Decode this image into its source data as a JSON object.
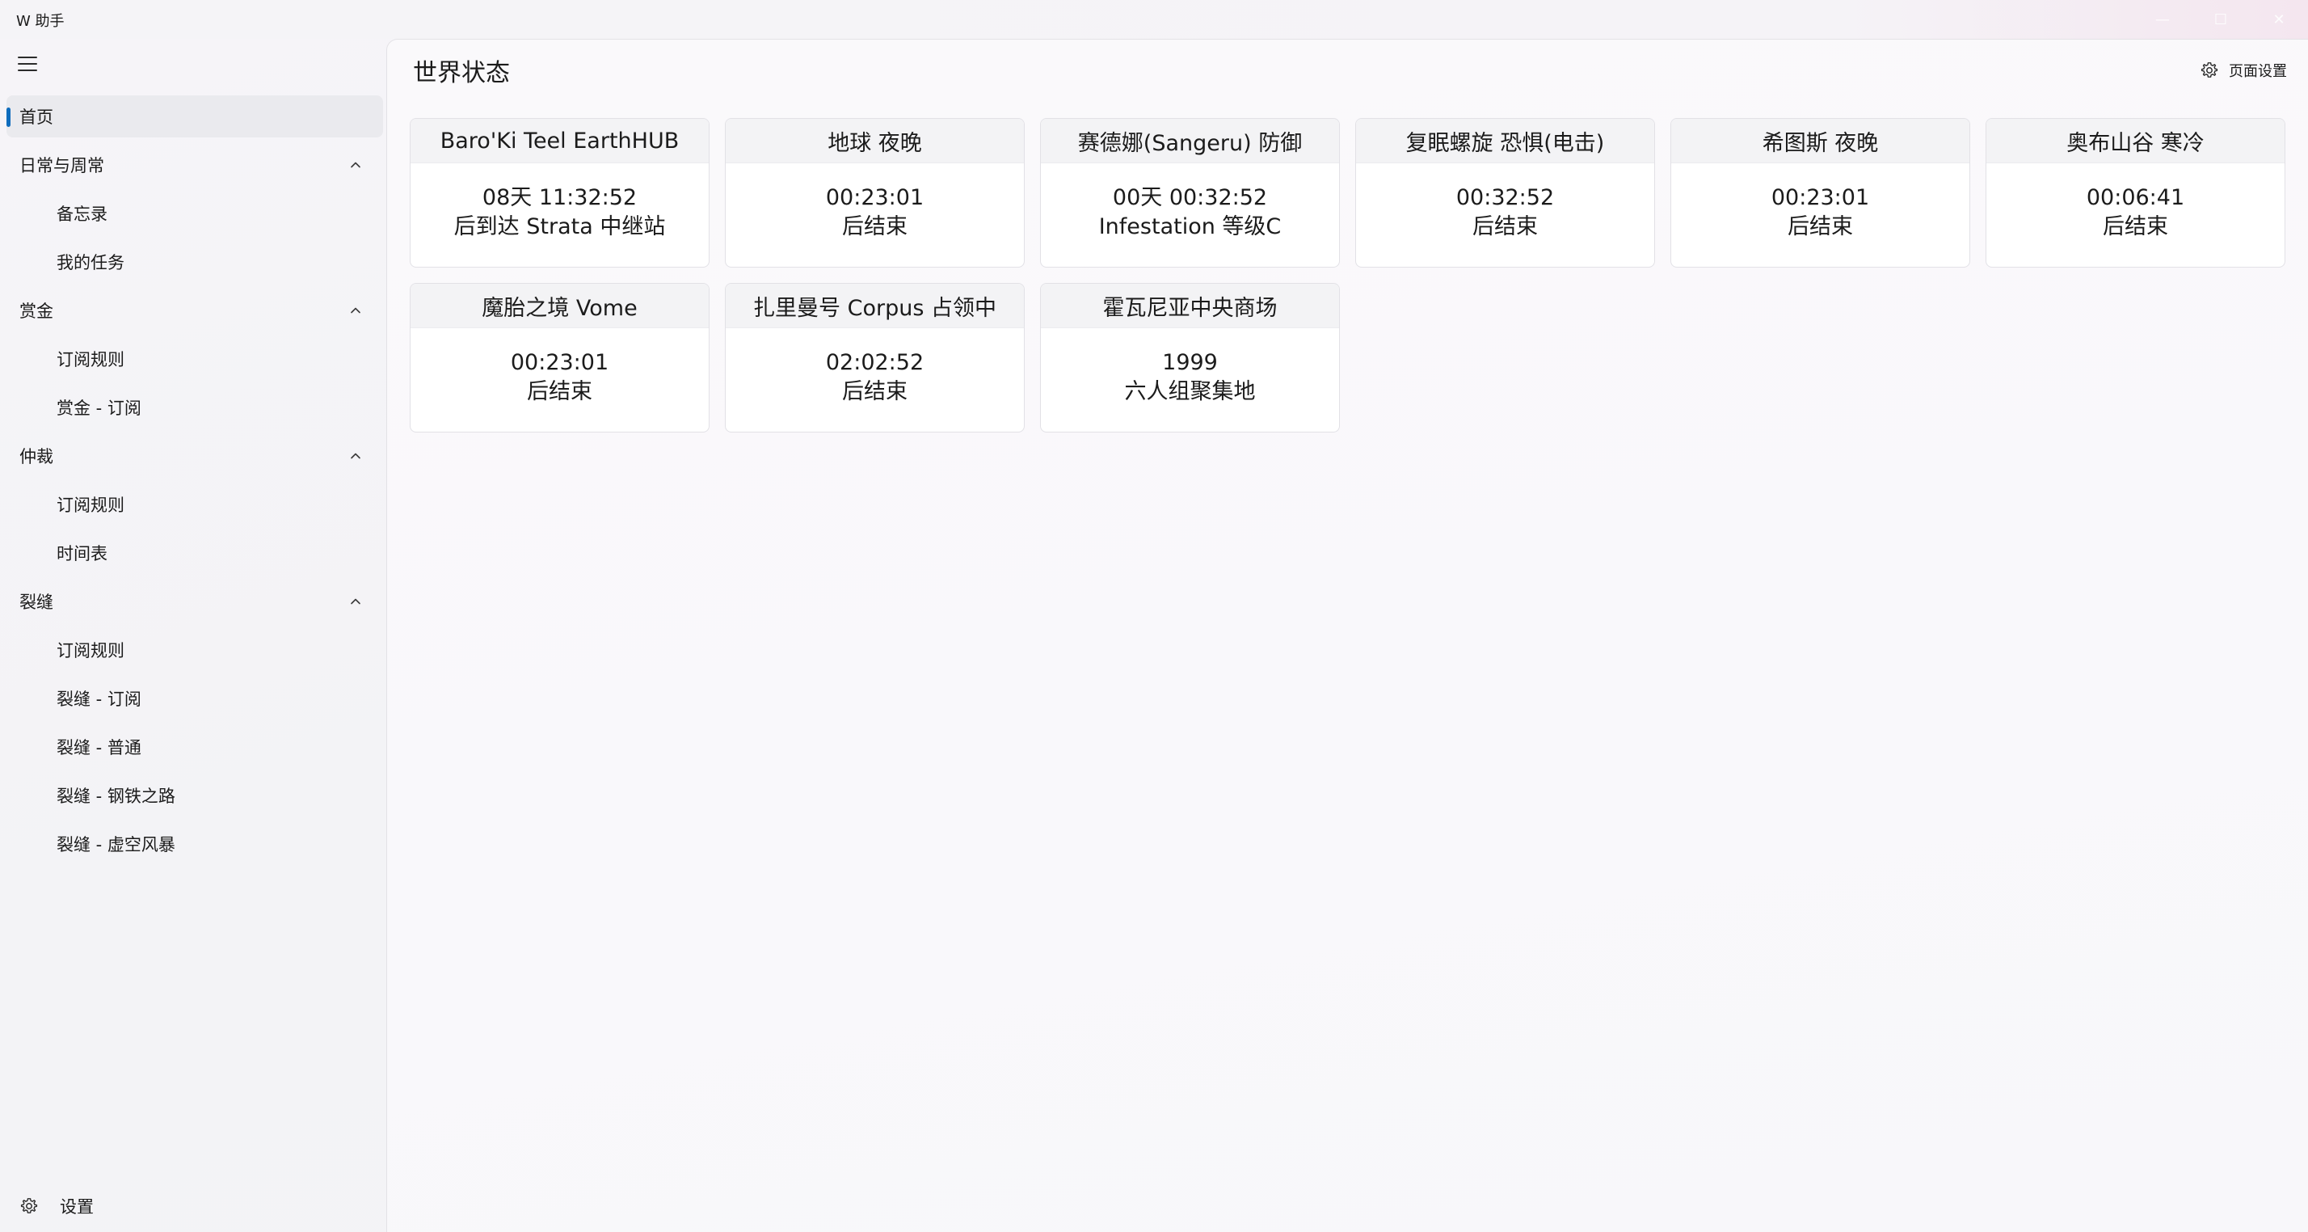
{
  "app": {
    "title": "W 助手",
    "controls": {
      "minimize": "—",
      "maximize": "☐",
      "close": "✕"
    }
  },
  "sidebar": {
    "home": "首页",
    "groups": [
      {
        "label": "日常与周常",
        "children": [
          "备忘录",
          "我的任务"
        ]
      },
      {
        "label": "赏金",
        "children": [
          "订阅规则",
          "赏金 - 订阅"
        ]
      },
      {
        "label": "仲裁",
        "children": [
          "订阅规则",
          "时间表"
        ]
      },
      {
        "label": "裂缝",
        "children": [
          "订阅规则",
          "裂缝 - 订阅",
          "裂缝 - 普通",
          "裂缝 - 钢铁之路",
          "裂缝 - 虚空风暴"
        ]
      }
    ],
    "settings": "设置"
  },
  "page": {
    "title": "世界状态",
    "settings_label": "页面设置"
  },
  "cards": [
    {
      "title": "Baro'Ki Teel EarthHUB",
      "line1": "08天 11:32:52",
      "line2": "后到达 Strata 中继站"
    },
    {
      "title": "地球 夜晚",
      "line1": "00:23:01",
      "line2": "后结束"
    },
    {
      "title": "赛德娜(Sangeru) 防御",
      "line1": "00天 00:32:52",
      "line2": "Infestation 等级C"
    },
    {
      "title": "复眠螺旋 恐惧(电击)",
      "line1": "00:32:52",
      "line2": "后结束"
    },
    {
      "title": "希图斯 夜晚",
      "line1": "00:23:01",
      "line2": "后结束"
    },
    {
      "title": "奥布山谷 寒冷",
      "line1": "00:06:41",
      "line2": "后结束"
    },
    {
      "title": "魔胎之境 Vome",
      "line1": "00:23:01",
      "line2": "后结束"
    },
    {
      "title": "扎里曼号 Corpus 占领中",
      "line1": "02:02:52",
      "line2": "后结束"
    },
    {
      "title": "霍瓦尼亚中央商场",
      "line1": "1999",
      "line2": "六人组聚集地"
    }
  ],
  "icons": {
    "menu": "hamburger-icon",
    "chevron": "chevron-up-icon",
    "settings": "gear-icon"
  },
  "colors": {
    "accent": "#0f6cbd"
  }
}
